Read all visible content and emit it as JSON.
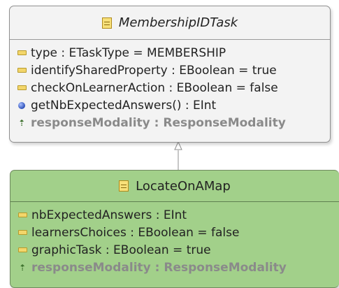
{
  "parent_class": {
    "name": "MembershipIDTask",
    "icon": "eclass-icon",
    "features": [
      {
        "kind": "attribute",
        "icon": "attribute-icon",
        "text": "type : ETaskType = MEMBERSHIP"
      },
      {
        "kind": "attribute",
        "icon": "attribute-icon",
        "text": "identifySharedProperty : EBoolean = true"
      },
      {
        "kind": "attribute",
        "icon": "attribute-icon",
        "text": "checkOnLearnerAction : EBoolean = false"
      },
      {
        "kind": "operation",
        "icon": "operation-icon",
        "text": "getNbExpectedAnswers() : EInt"
      },
      {
        "kind": "reference",
        "icon": "reference-icon",
        "text": "responseModality : ResponseModality"
      }
    ]
  },
  "child_class": {
    "name": "LocateOnAMap",
    "icon": "eclass-icon",
    "features": [
      {
        "kind": "attribute",
        "icon": "attribute-icon",
        "text": "nbExpectedAnswers : EInt"
      },
      {
        "kind": "attribute",
        "icon": "attribute-icon",
        "text": "learnersChoices : EBoolean = false"
      },
      {
        "kind": "attribute",
        "icon": "attribute-icon",
        "text": "graphicTask : EBoolean = true"
      },
      {
        "kind": "reference",
        "icon": "reference-icon",
        "text": "responseModality : ResponseModality"
      }
    ]
  },
  "colors": {
    "parent_fill": "#f3f3f3",
    "child_fill": "#a2d08a",
    "attribute_icon": "#f3d66b",
    "operation_icon": "#2c4fb8",
    "reference_text": "#8a8a8a"
  }
}
